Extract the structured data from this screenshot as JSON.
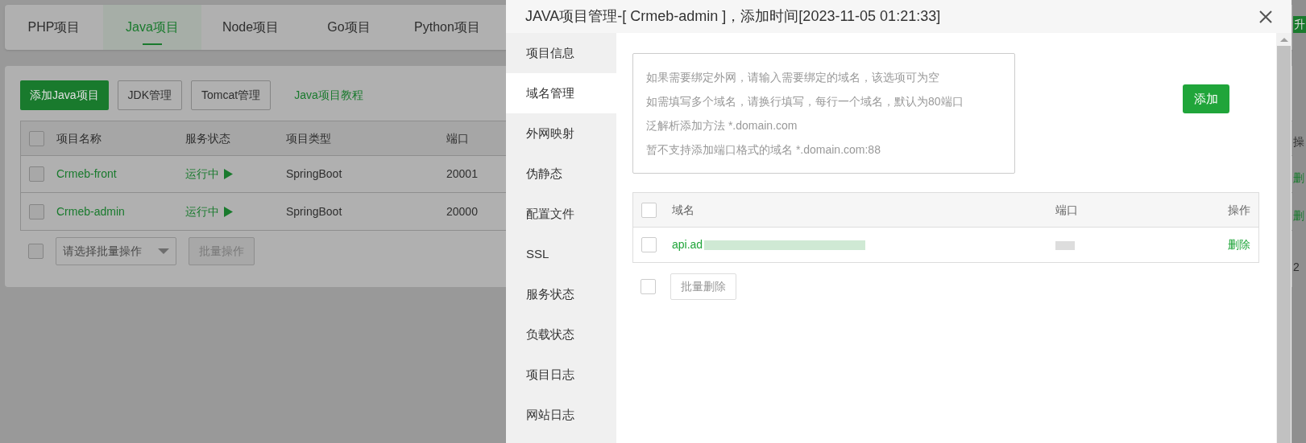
{
  "background_page": {
    "tabs": [
      {
        "label": "PHP项目",
        "selected": false
      },
      {
        "label": "Java项目",
        "selected": true
      },
      {
        "label": "Node项目",
        "selected": false
      },
      {
        "label": "Go项目",
        "selected": false
      },
      {
        "label": "Python项目",
        "selected": false
      }
    ],
    "toolbar": {
      "add_button": "添加Java项目",
      "buttons": [
        "JDK管理",
        "Tomcat管理"
      ],
      "tutorial_link": "Java项目教程"
    },
    "table": {
      "all_checked": false,
      "columns": [
        "项目名称",
        "服务状态",
        "项目类型",
        "端口"
      ],
      "rows": [
        {
          "name": "Crmeb-front",
          "status": "运行中",
          "type": "SpringBoot",
          "port": "20001",
          "checked": false
        },
        {
          "name": "Crmeb-admin",
          "status": "运行中",
          "type": "SpringBoot",
          "port": "20000",
          "checked": false
        }
      ]
    },
    "batch": {
      "all_checked": false,
      "select_placeholder": "请选择批量操作",
      "button": "批量操作"
    },
    "right_edge": {
      "upgrade": "升",
      "column": "操",
      "row_actions": [
        "删",
        "删"
      ],
      "count": "2"
    }
  },
  "dialog": {
    "title": "JAVA项目管理-[ Crmeb-admin ]，添加时间[2023-11-05 01:21:33]",
    "sidebar": [
      {
        "label": "项目信息",
        "selected": false
      },
      {
        "label": "域名管理",
        "selected": true
      },
      {
        "label": "外网映射",
        "selected": false
      },
      {
        "label": "伪静态",
        "selected": false
      },
      {
        "label": "配置文件",
        "selected": false
      },
      {
        "label": "SSL",
        "selected": false
      },
      {
        "label": "服务状态",
        "selected": false
      },
      {
        "label": "负载状态",
        "selected": false
      },
      {
        "label": "项目日志",
        "selected": false
      },
      {
        "label": "网站日志",
        "selected": false
      }
    ],
    "domain_input": {
      "placeholder_lines": [
        "如果需要绑定外网，请输入需要绑定的域名，该选项可为空",
        "如需填写多个域名，请换行填写，每行一个域名，默认为80端口",
        "泛解析添加方法 *.domain.com",
        "暂不支持添加端口格式的域名 *.domain.com:88"
      ]
    },
    "add_button": "添加",
    "domain_table": {
      "all_checked": false,
      "columns": [
        "域名",
        "端口",
        "操作"
      ],
      "rows": [
        {
          "domain": "api.ad",
          "action": "删除",
          "checked": false
        }
      ]
    },
    "batch_delete": {
      "all_checked": false,
      "button": "批量删除"
    }
  }
}
